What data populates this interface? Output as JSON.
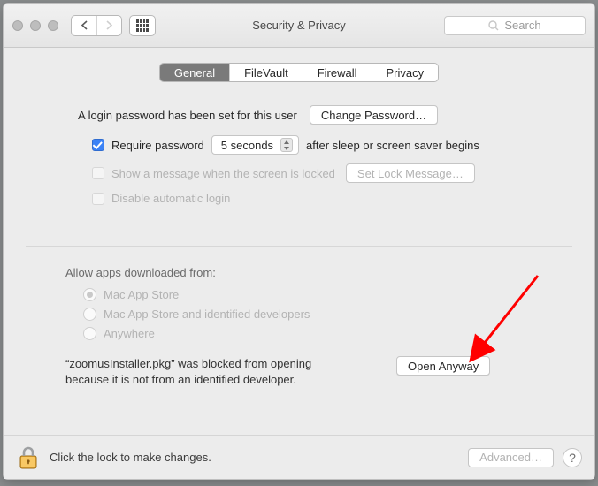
{
  "window": {
    "title": "Security & Privacy",
    "search_placeholder": "Search"
  },
  "tabs": {
    "general": "General",
    "filevault": "FileVault",
    "firewall": "Firewall",
    "privacy": "Privacy",
    "active": "general"
  },
  "general": {
    "login_password_set": "A login password has been set for this user",
    "change_password_btn": "Change Password…",
    "require_password": {
      "checked": true,
      "label_before": "Require password",
      "delay_value": "5 seconds",
      "label_after": "after sleep or screen saver begins"
    },
    "show_message": {
      "checked": false,
      "enabled": false,
      "label": "Show a message when the screen is locked",
      "button": "Set Lock Message…"
    },
    "disable_auto_login": {
      "checked": false,
      "enabled": false,
      "label": "Disable automatic login"
    },
    "allow_apps": {
      "title": "Allow apps downloaded from:",
      "options": {
        "mas": "Mac App Store",
        "mas_id": "Mac App Store and identified developers",
        "anywhere": "Anywhere"
      },
      "selected": "mas",
      "enabled": false
    },
    "blocked": {
      "message": "“zoomusInstaller.pkg” was blocked from opening because it is not from an identified developer.",
      "button": "Open Anyway"
    }
  },
  "footer": {
    "lock_text": "Click the lock to make changes.",
    "advanced_btn": "Advanced…",
    "help_label": "?"
  },
  "annotation": {
    "arrow_target": "open-anyway-button",
    "color": "#ff0000"
  }
}
